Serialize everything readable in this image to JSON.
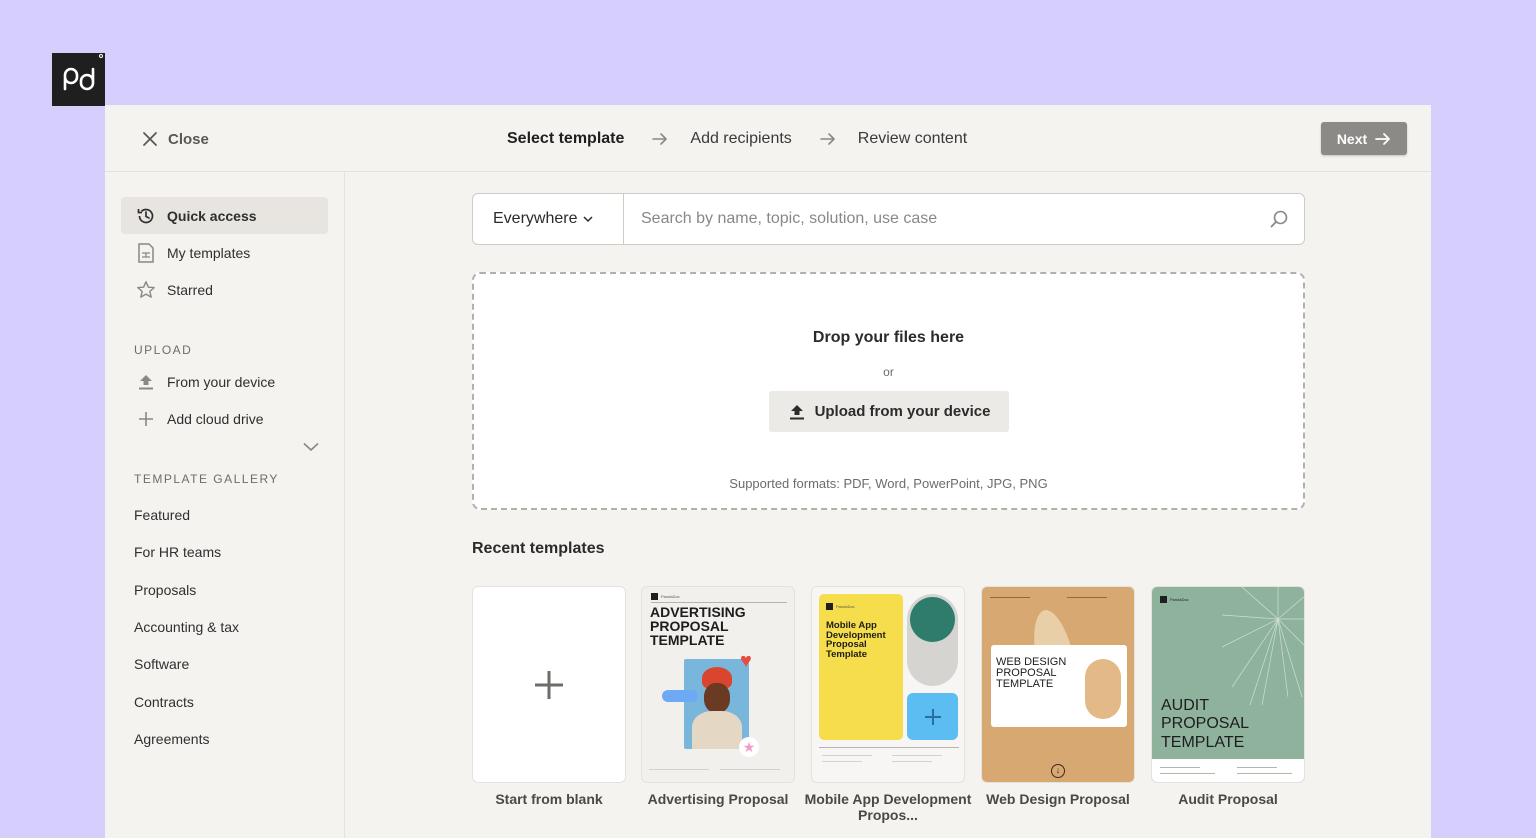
{
  "brand": {
    "logo_icon": "pandadoc-logo-icon"
  },
  "header": {
    "close_label": "Close",
    "steps": [
      "Select template",
      "Add recipients",
      "Review content"
    ],
    "next_label": "Next"
  },
  "sidebar": {
    "quick_items": [
      {
        "label": "Quick access",
        "icon": "history-icon"
      },
      {
        "label": "My templates",
        "icon": "document-icon"
      },
      {
        "label": "Starred",
        "icon": "star-icon"
      }
    ],
    "upload_heading": "UPLOAD",
    "upload_items": [
      {
        "label": "From your device",
        "icon": "upload-icon"
      },
      {
        "label": "Add cloud drive",
        "icon": "plus-icon"
      }
    ],
    "gallery_heading": "TEMPLATE GALLERY",
    "gallery_items": [
      "Featured",
      "For HR teams",
      "Proposals",
      "Accounting & tax",
      "Software",
      "Contracts",
      "Agreements"
    ]
  },
  "search": {
    "scope": "Everywhere",
    "placeholder": "Search by name, topic, solution, use case"
  },
  "dropzone": {
    "title": "Drop your files here",
    "or": "or",
    "button": "Upload from your device",
    "formats": "Supported formats: PDF, Word, PowerPoint, JPG, PNG"
  },
  "recent": {
    "title": "Recent templates",
    "cards": [
      {
        "label": "Start from blank"
      },
      {
        "label": "Advertising Proposal",
        "thumb_title": "ADVERTISING PROPOSAL TEMPLATE",
        "brand": "PandaDoc"
      },
      {
        "label": "Mobile App Development Propos...",
        "thumb_title": "Mobile App Development Proposal Template",
        "brand": "PandaDoc"
      },
      {
        "label": "Web Design Proposal",
        "thumb_title": "WEB DESIGN PROPOSAL TEMPLATE"
      },
      {
        "label": "Audit Proposal",
        "thumb_title": "AUDIT PROPOSAL TEMPLATE",
        "brand": "PandaDoc"
      }
    ]
  },
  "colors": {
    "page_bg": "#d6cffd",
    "panel_bg": "#f5f3f0",
    "next_button": "#8c8a86",
    "mobile_yellow": "#f6dd4b",
    "mobile_teal": "#2f7c6c",
    "mobile_blue": "#5bbdf2",
    "web_tan": "#d7a872",
    "audit_green": "#8fb29d"
  }
}
